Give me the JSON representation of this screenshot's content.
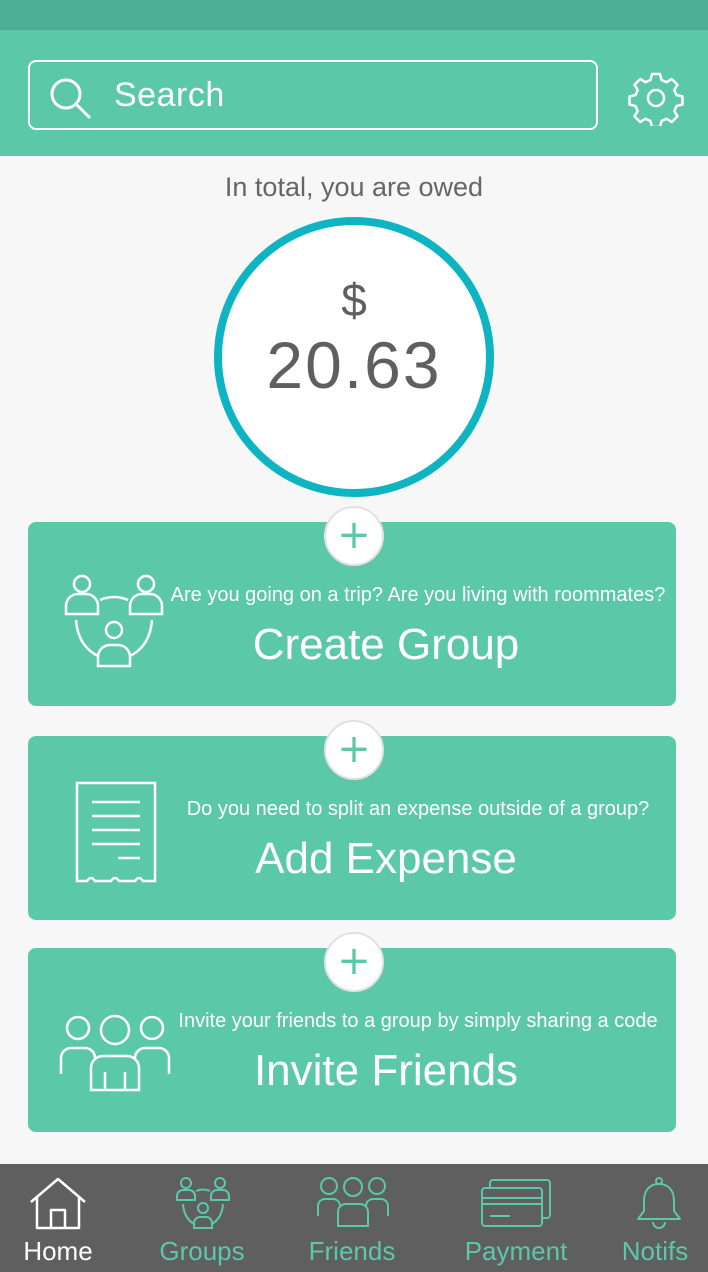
{
  "header": {
    "search_placeholder": "Search",
    "icons": {
      "search": "search-icon",
      "settings": "gear-icon"
    }
  },
  "balance": {
    "label": "In total, you are owed",
    "currency": "$",
    "amount": "20.63"
  },
  "cards": [
    {
      "subtitle": "Are you going on a trip? Are you living with roommates?",
      "title": "Create Group",
      "icon": "group-icon",
      "plus": "+"
    },
    {
      "subtitle": "Do you need to split an expense outside of a group?",
      "title": "Add Expense",
      "icon": "receipt-icon",
      "plus": "+"
    },
    {
      "subtitle": "Invite your friends to a group by simply sharing a code",
      "title": "Invite Friends",
      "icon": "friends-icon",
      "plus": "+"
    }
  ],
  "tabs": [
    {
      "label": "Home",
      "icon": "home-icon",
      "active": true
    },
    {
      "label": "Groups",
      "icon": "group-icon",
      "active": false
    },
    {
      "label": "Friends",
      "icon": "friends-icon",
      "active": false
    },
    {
      "label": "Payment",
      "icon": "card-icon",
      "active": false
    },
    {
      "label": "Notifs",
      "icon": "bell-icon",
      "active": false
    }
  ],
  "colors": {
    "accent": "#5bc8a7",
    "status_bar": "#4daf94",
    "ring": "#0fb4c2",
    "tab_bar": "#5f5f5f",
    "text_gray": "#5f5f5f"
  }
}
